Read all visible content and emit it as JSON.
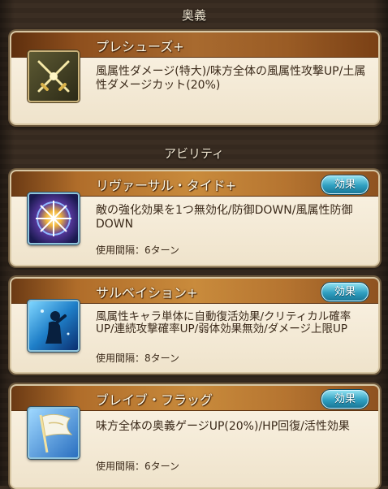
{
  "ougi_section": {
    "title": "奥義"
  },
  "ougi": {
    "name": "プレシューズ+",
    "description": "風属性ダメージ(特大)/味方全体の風属性攻撃UP/土属性ダメージカット(20%)",
    "icon": "crossed-swords-icon"
  },
  "ability_section": {
    "title": "アビリティ"
  },
  "effect_label": "効果",
  "abilities": [
    {
      "name": "リヴァーサル・タイド+",
      "description": "敵の強化効果を1つ無効化/防御DOWN/風属性防御DOWN",
      "cooldown": "使用間隔：6ターン",
      "icon": "swirl-burst-icon"
    },
    {
      "name": "サルベイション+",
      "description": "風属性キャラ単体に自動復活効果/クリティカル確率UP/連続攻撃確率UP/弱体効果無効/ダメージ上限UP",
      "cooldown": "使用間隔：8ターン",
      "icon": "praying-figure-icon"
    },
    {
      "name": "ブレイブ・フラッグ",
      "description": "味方全体の奥義ゲージUP(20%)/HP回復/活性効果",
      "cooldown": "使用間隔：6ターン",
      "icon": "flag-icon"
    }
  ]
}
